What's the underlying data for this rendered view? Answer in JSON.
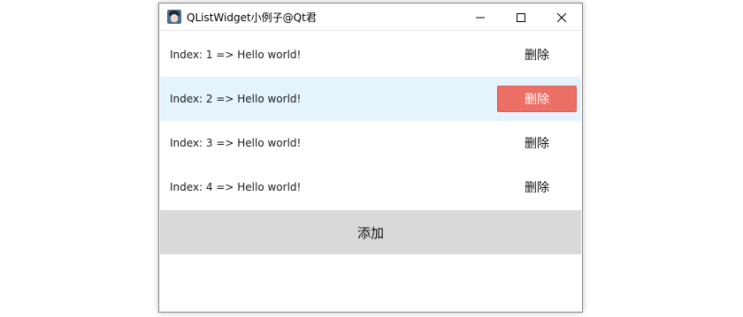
{
  "window": {
    "title": "QListWidget小例子@Qt君",
    "app_icon": "avatar-app-icon",
    "controls": [
      "minimize-icon",
      "maximize-icon",
      "close-icon"
    ]
  },
  "list": {
    "items": [
      {
        "label": "Index: 1 => Hello world!",
        "action": "删除",
        "selected": false
      },
      {
        "label": "Index: 2 => Hello world!",
        "action": "删除",
        "selected": true
      },
      {
        "label": "Index: 3 => Hello world!",
        "action": "删除",
        "selected": false
      },
      {
        "label": "Index: 4 => Hello world!",
        "action": "删除",
        "selected": false
      }
    ]
  },
  "add_button": {
    "label": "添加"
  },
  "colors": {
    "selected_row": "#e5f3fd",
    "delete_highlight": "#ec6f66",
    "add_button_bg": "#d9d9d9"
  }
}
